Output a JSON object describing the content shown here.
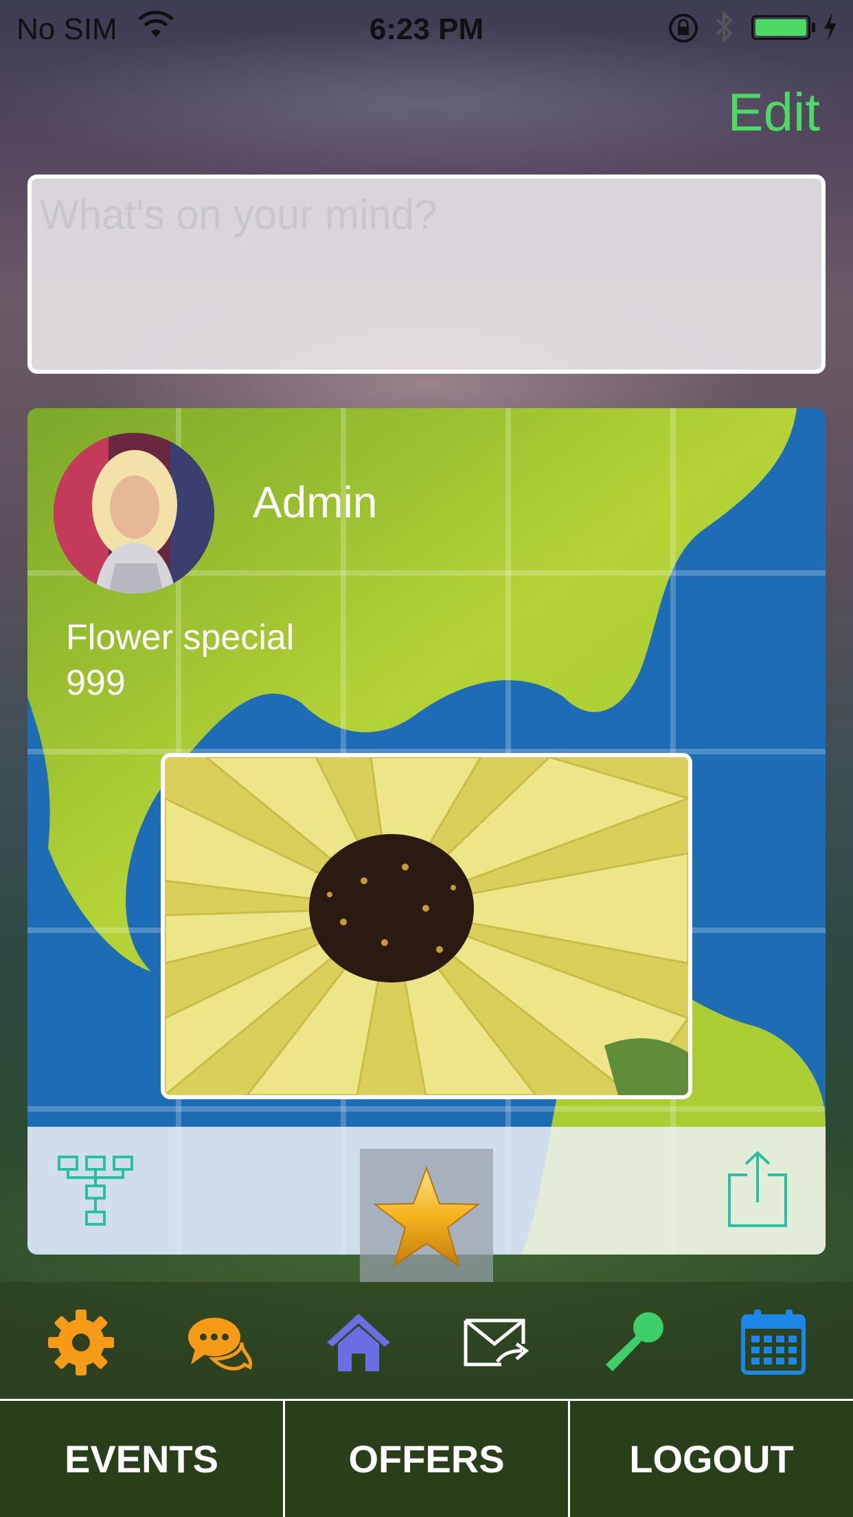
{
  "status_bar": {
    "carrier": "No SIM",
    "time": "6:23 PM",
    "icons": [
      "wifi-icon",
      "orientation-lock-icon",
      "bluetooth-icon",
      "battery-icon",
      "charging-icon"
    ]
  },
  "header": {
    "edit_label": "Edit"
  },
  "composer": {
    "placeholder": "What's on your mind?"
  },
  "post": {
    "author_name": "Admin",
    "title": "Flower special",
    "price": "999",
    "actions": {
      "left_icon": "hierarchy-icon",
      "center_icon": "star-icon",
      "right_icon": "share-icon"
    }
  },
  "nav_icons": [
    "gear-icon",
    "chat-icon",
    "home-icon",
    "mail-forward-icon",
    "microphone-icon",
    "calendar-icon"
  ],
  "bottom_tabs": [
    "EVENTS",
    "OFFERS",
    "LOGOUT"
  ],
  "colors": {
    "accent_green": "#4cd964",
    "icon_teal": "#2bbfa0",
    "gear_orange": "#f59b17",
    "home_purple": "#6a6ee0",
    "calendar_blue": "#1b87e6",
    "star_gold": "#f2b31d"
  }
}
